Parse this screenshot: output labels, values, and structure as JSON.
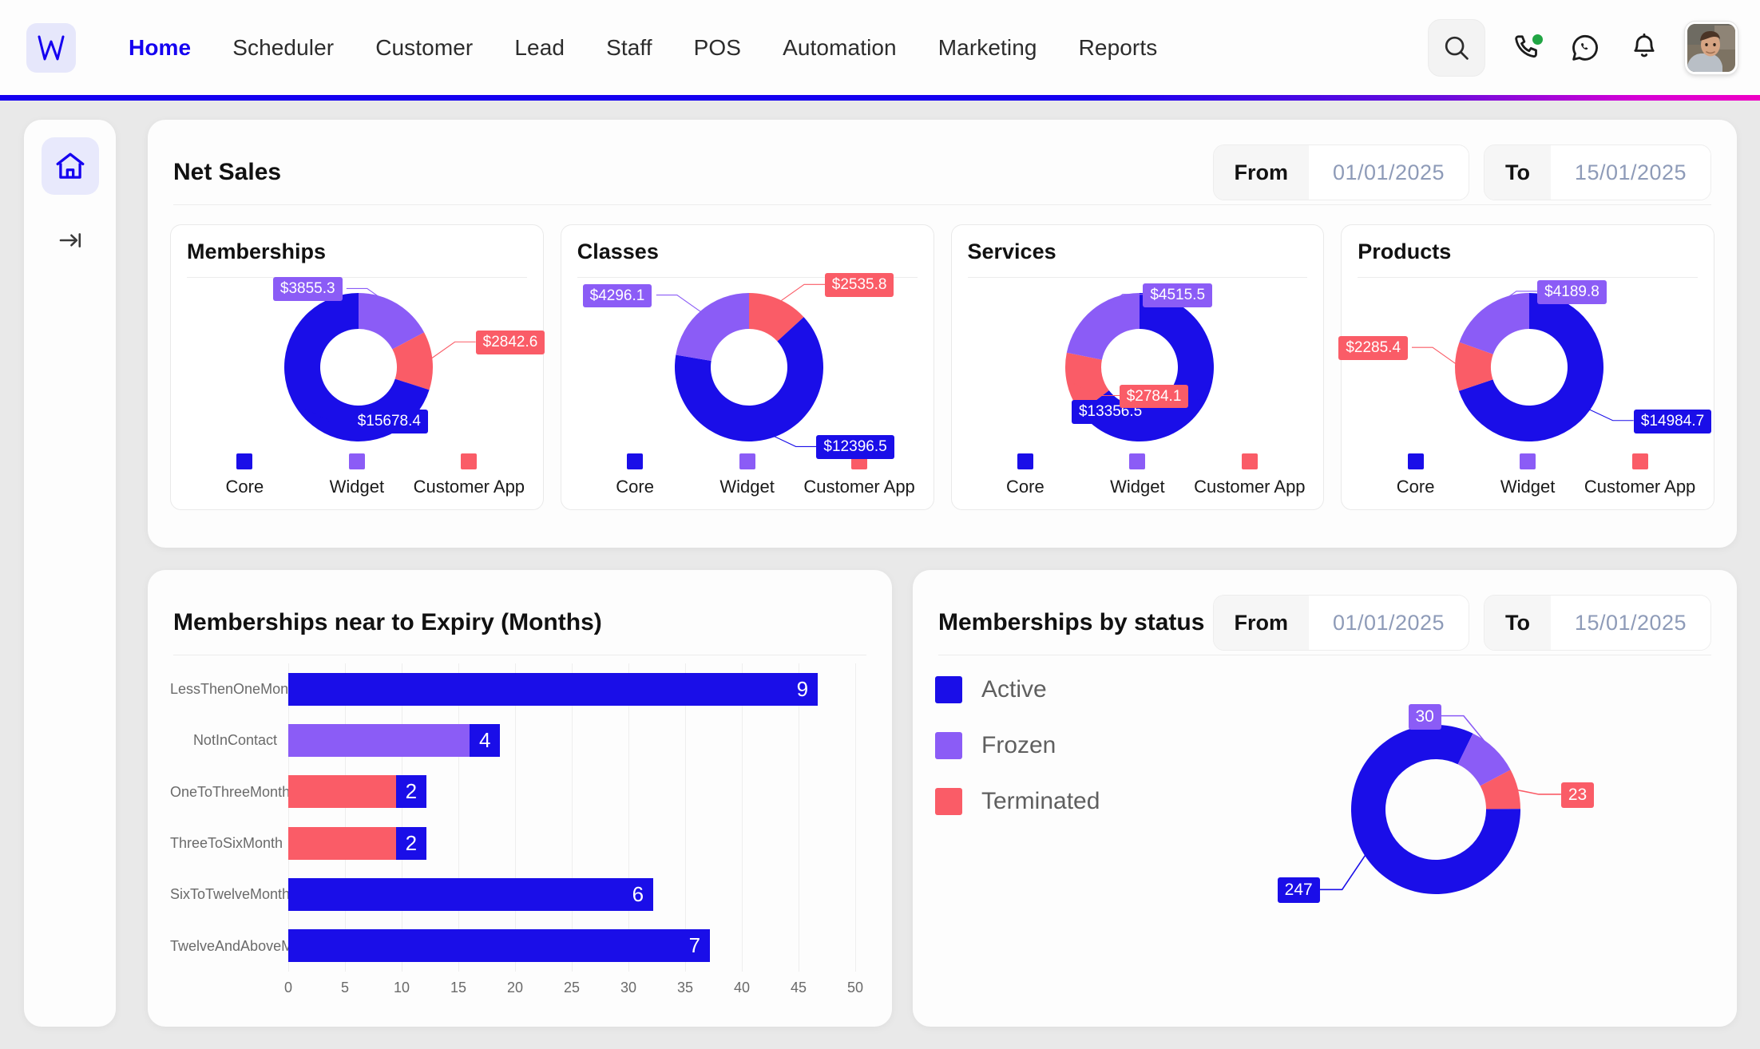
{
  "header": {
    "logo_alt": "W",
    "nav": [
      {
        "label": "Home",
        "active": true
      },
      {
        "label": "Scheduler",
        "active": false
      },
      {
        "label": "Customer",
        "active": false
      },
      {
        "label": "Lead",
        "active": false
      },
      {
        "label": "Staff",
        "active": false
      },
      {
        "label": "POS",
        "active": false
      },
      {
        "label": "Automation",
        "active": false
      },
      {
        "label": "Marketing",
        "active": false
      },
      {
        "label": "Reports",
        "active": false
      }
    ],
    "icons": [
      "search-icon",
      "phone-call-icon",
      "whatsapp-icon",
      "bell-icon",
      "avatar"
    ],
    "accent_color": "#1500f0",
    "gradient_from": "#1500f0",
    "gradient_to": "#ef00c4"
  },
  "sidebar": {
    "items": [
      {
        "name": "home-icon",
        "active": true
      },
      {
        "name": "collapse-icon",
        "active": false
      }
    ]
  },
  "net_sales": {
    "title": "Net Sales",
    "from_label": "From",
    "from_value": "01/01/2025",
    "to_label": "To",
    "to_value": "15/01/2025",
    "legend": [
      "Core",
      "Widget",
      "Customer App"
    ],
    "colors": {
      "core": "#1a0ee8",
      "widget": "#8b5cf6",
      "customer_app": "#fa5c67"
    }
  },
  "memberships_by_status": {
    "title": "Memberships by status",
    "from_label": "From",
    "from_value": "01/01/2025",
    "to_label": "To",
    "to_value": "15/01/2025",
    "legend": [
      {
        "label": "Active",
        "color": "#1a0ee8"
      },
      {
        "label": "Frozen",
        "color": "#8b5cf6"
      },
      {
        "label": "Terminated",
        "color": "#fa5c67"
      }
    ]
  },
  "expiry": {
    "title": "Memberships near to Expiry (Months)"
  },
  "chart_data": [
    {
      "type": "pie",
      "title": "Memberships",
      "categories": [
        "Core",
        "Widget",
        "Customer App"
      ],
      "values": [
        15678.4,
        3855.3,
        2842.6
      ],
      "labels": [
        "$15678.4",
        "$3855.3",
        "$2842.6"
      ],
      "colors": [
        "#1a0ee8",
        "#8b5cf6",
        "#fa5c67"
      ],
      "legend_position": "bottom"
    },
    {
      "type": "pie",
      "title": "Classes",
      "categories": [
        "Core",
        "Widget",
        "Customer App"
      ],
      "values": [
        12396.5,
        4296.1,
        2535.8
      ],
      "labels": [
        "$12396.5",
        "$4296.1",
        "$2535.8"
      ],
      "colors": [
        "#1a0ee8",
        "#8b5cf6",
        "#fa5c67"
      ],
      "legend_position": "bottom"
    },
    {
      "type": "pie",
      "title": "Services",
      "categories": [
        "Core",
        "Widget",
        "Customer App"
      ],
      "values": [
        13356.5,
        4515.5,
        2784.1
      ],
      "labels": [
        "$13356.5",
        "$4515.5",
        "$2784.1"
      ],
      "colors": [
        "#1a0ee8",
        "#8b5cf6",
        "#fa5c67"
      ],
      "legend_position": "bottom"
    },
    {
      "type": "pie",
      "title": "Products",
      "categories": [
        "Core",
        "Widget",
        "Customer App"
      ],
      "values": [
        14984.7,
        4189.8,
        2285.4
      ],
      "labels": [
        "$14984.7",
        "$4189.8",
        "$2285.4"
      ],
      "colors": [
        "#1a0ee8",
        "#8b5cf6",
        "#fa5c67"
      ],
      "legend_position": "bottom"
    },
    {
      "type": "bar",
      "orientation": "horizontal",
      "title": "Memberships near to Expiry (Months)",
      "categories": [
        "LessThenOneMonth",
        "NotInContact",
        "OneToThreeMonth",
        "ThreeToSixMonth",
        "SixToTwelveMonth",
        "TwelveAndAboveMonth"
      ],
      "values": [
        44,
        16,
        9.5,
        9.5,
        29.5,
        34.5
      ],
      "data_labels": [
        "9",
        "4",
        "2",
        "2",
        "6",
        "7"
      ],
      "bar_colors": [
        "#1a0ee8",
        "#8b5cf6",
        "#fa5c67",
        "#fa5c67",
        "#1a0ee8",
        "#1a0ee8"
      ],
      "xlabel": "",
      "ylabel": "",
      "xlim": [
        0,
        50
      ],
      "xticks": [
        "0",
        "5",
        "10",
        "15",
        "20",
        "25",
        "30",
        "35",
        "40",
        "45",
        "50"
      ],
      "grid": true
    },
    {
      "type": "pie",
      "title": "Memberships by status",
      "categories": [
        "Active",
        "Frozen",
        "Terminated"
      ],
      "values": [
        247,
        30,
        23
      ],
      "labels": [
        "247",
        "30",
        "23"
      ],
      "colors": [
        "#1a0ee8",
        "#8b5cf6",
        "#fa5c67"
      ],
      "legend_position": "left"
    }
  ]
}
